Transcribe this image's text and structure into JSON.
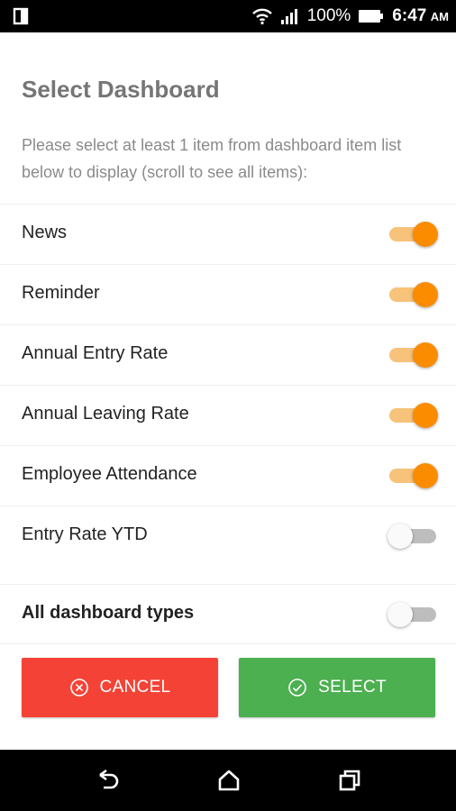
{
  "status_bar": {
    "battery": "100%",
    "time": "6:47",
    "ampm": "AM",
    "icons": [
      "sim-icon",
      "wifi-icon",
      "signal-icon",
      "battery-icon"
    ]
  },
  "dialog": {
    "title": "Select Dashboard",
    "description": "Please select at least 1 item from dashboard item list below to display (scroll to see all items):",
    "items": [
      {
        "label": "News",
        "enabled": true
      },
      {
        "label": "Reminder",
        "enabled": true
      },
      {
        "label": "Annual Entry Rate",
        "enabled": true
      },
      {
        "label": "Annual Leaving Rate",
        "enabled": true
      },
      {
        "label": "Employee Attendance",
        "enabled": true
      },
      {
        "label": "Entry Rate YTD",
        "enabled": false
      }
    ],
    "all_types": {
      "label": "All dashboard types",
      "enabled": false
    },
    "cancel_label": "CANCEL",
    "select_label": "SELECT"
  },
  "colors": {
    "accent": "#fb8c00",
    "cancel": "#f44336",
    "select": "#4caf50"
  },
  "nav_bar": {
    "icons": [
      "back-icon",
      "home-icon",
      "recents-icon"
    ]
  }
}
